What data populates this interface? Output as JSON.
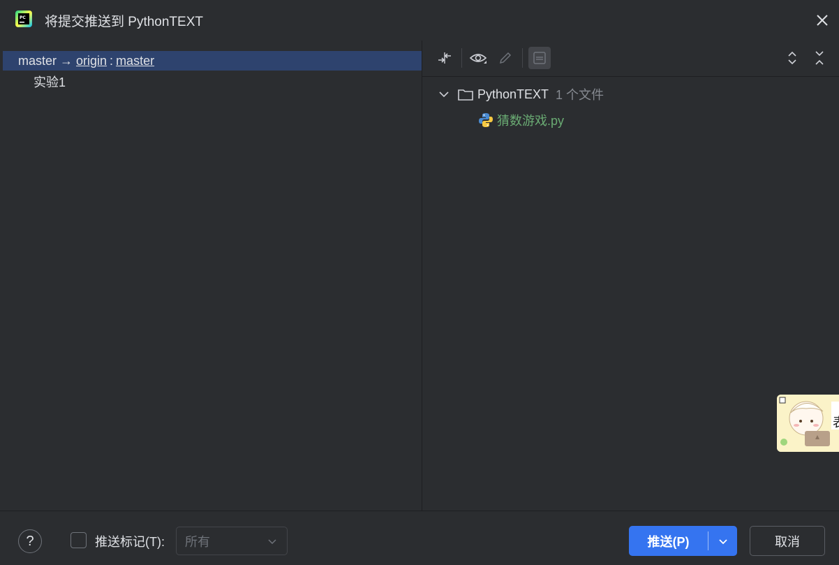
{
  "window": {
    "title": "将提交推送到 PythonTEXT",
    "app_icon": "pycharm-logo-icon",
    "close_icon": "close-icon"
  },
  "branches": {
    "local": "master",
    "arrow": "→",
    "remote": "origin",
    "separator": ":",
    "remote_branch": "master",
    "commits": [
      "实验1"
    ]
  },
  "toolbar": {
    "icons": [
      "merge-arrows-icon",
      "eye-icon",
      "pencil-icon",
      "diff-preview-icon",
      "expand-all-icon",
      "collapse-all-icon"
    ]
  },
  "tree": {
    "folder_name": "PythonTEXT",
    "file_count": "1 个文件",
    "files": [
      {
        "name": "猜数游戏.py",
        "icon": "python-file-icon",
        "color": "#6aab73"
      }
    ]
  },
  "footer": {
    "help_label": "?",
    "push_tags_label": "推送标记(T):",
    "push_tags_checked": false,
    "tags_select_value": "所有",
    "push_button": "推送(P)",
    "cancel_button": "取消"
  },
  "colors": {
    "background": "#2b2d30",
    "selection": "#2e436e",
    "accent": "#3574f0",
    "muted": "#868a91"
  }
}
